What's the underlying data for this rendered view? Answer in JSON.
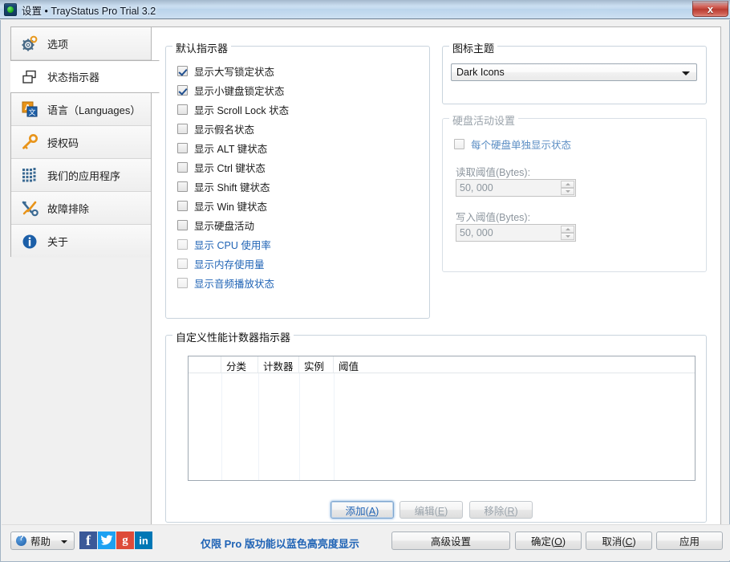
{
  "window": {
    "title": "设置 • TrayStatus Pro Trial 3.2",
    "icon": "traystatus-icon",
    "close_label": "x"
  },
  "sidebar": {
    "items": [
      {
        "label": "选项",
        "icon": "gear-icon",
        "selected": false
      },
      {
        "label": "状态指示器",
        "icon": "windows-cascade-icon",
        "selected": true
      },
      {
        "label": "语言（Languages）",
        "icon": "language-icon",
        "selected": false
      },
      {
        "label": "授权码",
        "icon": "key-icon",
        "selected": false
      },
      {
        "label": "我们的应用程序",
        "icon": "apps-grid-icon",
        "selected": false
      },
      {
        "label": "故障排除",
        "icon": "tools-icon",
        "selected": false
      },
      {
        "label": "关于",
        "icon": "info-icon",
        "selected": false
      }
    ]
  },
  "default_indicators": {
    "title": "默认指示器",
    "items": [
      {
        "label": "显示大写锁定状态",
        "checked": true,
        "pro": false,
        "disabled": false
      },
      {
        "label": "显示小键盘锁定状态",
        "checked": true,
        "pro": false,
        "disabled": false
      },
      {
        "label": "显示 Scroll Lock 状态",
        "checked": false,
        "pro": false,
        "disabled": false
      },
      {
        "label": "显示假名状态",
        "checked": false,
        "pro": false,
        "disabled": false
      },
      {
        "label": "显示 ALT 键状态",
        "checked": false,
        "pro": false,
        "disabled": false
      },
      {
        "label": "显示 Ctrl 键状态",
        "checked": false,
        "pro": false,
        "disabled": false
      },
      {
        "label": "显示 Shift 键状态",
        "checked": false,
        "pro": false,
        "disabled": false
      },
      {
        "label": "显示 Win 键状态",
        "checked": false,
        "pro": false,
        "disabled": false
      },
      {
        "label": "显示硬盘活动",
        "checked": false,
        "pro": false,
        "disabled": false
      },
      {
        "label": "显示 CPU 使用率",
        "checked": false,
        "pro": true,
        "disabled": false
      },
      {
        "label": "显示内存使用量",
        "checked": false,
        "pro": true,
        "disabled": false
      },
      {
        "label": "显示音频播放状态",
        "checked": false,
        "pro": true,
        "disabled": false
      }
    ]
  },
  "icon_theme": {
    "title": "图标主题",
    "selected": "Dark Icons",
    "options": [
      "Dark Icons"
    ]
  },
  "disk_activity": {
    "title": "硬盘活动设置",
    "disabled": true,
    "per_disk": {
      "label": "每个硬盘单独显示状态",
      "checked": false
    },
    "read_threshold": {
      "label": "读取阈值(Bytes):",
      "value": "50, 000"
    },
    "write_threshold": {
      "label": "写入阈值(Bytes):",
      "value": "50, 000"
    }
  },
  "custom_counters": {
    "title": "自定义性能计数器指示器",
    "columns": [
      "",
      "分类",
      "计数器",
      "实例",
      "阈值"
    ],
    "rows": [],
    "buttons": {
      "add": {
        "label": "添加(A)",
        "accel": "A",
        "pro": true,
        "disabled": false,
        "focused": true
      },
      "edit": {
        "label": "编辑(E)",
        "accel": "E",
        "pro": false,
        "disabled": true,
        "focused": false
      },
      "remove": {
        "label": "移除(R)",
        "accel": "R",
        "pro": false,
        "disabled": true,
        "focused": false
      }
    }
  },
  "footer": {
    "help": {
      "label": "帮助",
      "icon": "help-icon",
      "dropdown_icon": "chevron-down-icon"
    },
    "social": [
      {
        "name": "facebook-icon",
        "glyph": "f",
        "color": "#3b5998"
      },
      {
        "name": "twitter-icon",
        "glyph": "🐦",
        "color": "#1da1f2"
      },
      {
        "name": "googleplus-icon",
        "glyph": "g",
        "color": "#dd4b39"
      },
      {
        "name": "linkedin-icon",
        "glyph": "in",
        "color": "#0077b5"
      }
    ],
    "pro_notice": "仅限 Pro 版功能以蓝色高亮度显示",
    "buttons": {
      "advanced": "高级设置",
      "ok": "确定(O)",
      "cancel": "取消(C)",
      "apply": "应用"
    }
  },
  "colors": {
    "pro_blue": "#1f63b5",
    "accent": "#21508f",
    "window_bg": "#f0f0f0"
  }
}
